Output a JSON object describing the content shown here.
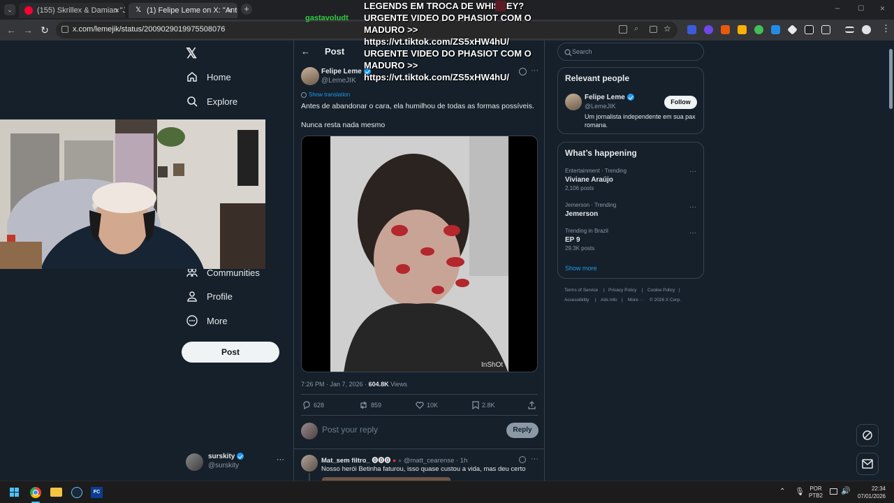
{
  "browser": {
    "tabs": [
      {
        "title": "(155) Skrillex & Damian \"Jr. Go..."
      },
      {
        "title": "(1) Felipe Leme on X: \"Ante..."
      }
    ],
    "url": "x.com/lemejik/status/2009029019975508076"
  },
  "overlay": {
    "username": "gastavoludt",
    "lines": [
      "LEGENDS EM TROCA DE WHISKEY?",
      "URGENTE VIDEO DO PHASIOT COM O",
      "MADURO >>",
      "https://vt.tiktok.com/ZS5xHW4hU/",
      "URGENTE VIDEO DO PHASIOT COM O",
      "MADURO >>",
      "https://vt.tiktok.com/ZS5xHW4hU/"
    ]
  },
  "nav": {
    "home": "Home",
    "explore": "Explore",
    "communities": "Communities",
    "profile": "Profile",
    "more": "More",
    "post_button": "Post"
  },
  "account": {
    "name": "surskity",
    "handle": "@surskity"
  },
  "header": {
    "title": "Post"
  },
  "post": {
    "author_name": "Felipe Leme",
    "author_handle": "@LemeJIK",
    "translate": "Show translation",
    "text1": "Antes de abandonar o cara, ela humilhou de todas as formas possíveis.",
    "text2": "Nunca resta nada mesmo",
    "video_watermark": "InShOt",
    "timestamp": "7:26 PM · Jan 7, 2026 · ",
    "views_count": "604.8K",
    "views_label": " Views",
    "replies": "628",
    "reposts": "859",
    "likes": "10K",
    "bookmarks": "2.8K"
  },
  "reply_box": {
    "placeholder": "Post your reply",
    "button": "Reply"
  },
  "reply": {
    "name": "Mat_sem filtro_",
    "handle": "@matt_cearense · 1h",
    "text": "Nosso herói Betinha faturou, isso quase custou a vida, mas deu certo"
  },
  "search": {
    "placeholder": "Search"
  },
  "relevant": {
    "heading": "Relevant people",
    "name": "Felipe Leme",
    "handle": "@LemeJIK",
    "bio": "Um jornalista independente em sua pax romana.",
    "follow": "Follow"
  },
  "happening": {
    "heading": "What’s happening",
    "trends": [
      {
        "category": "Entertainment · Trending",
        "name": "Viviane Araújo",
        "count": "2,106 posts"
      },
      {
        "category": "Jemerson · Trending",
        "name": "Jemerson",
        "count": ""
      },
      {
        "category": "Trending in Brazil",
        "name": "EP 9",
        "count": "29.3K posts"
      }
    ],
    "show_more": "Show more"
  },
  "footer": {
    "links": [
      "Terms of Service",
      "Privacy Policy",
      "Cookie Policy",
      "Accessibility",
      "Ads info",
      "More ···",
      "© 2026 X Corp."
    ]
  },
  "taskbar": {
    "lang1": "POR",
    "lang2": "PTB2",
    "time": "22:34",
    "date": "07/01/2026"
  },
  "colors": {
    "background": "#15202b",
    "accent": "#1d9bf0",
    "border": "#38444d"
  }
}
